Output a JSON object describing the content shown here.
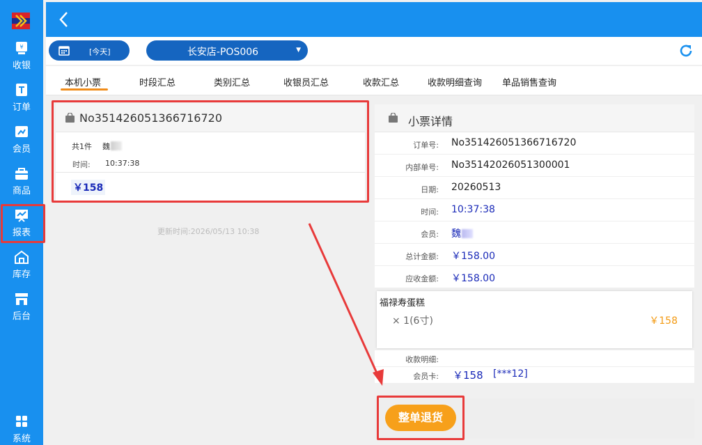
{
  "sidebar": {
    "items": [
      {
        "label": "收银",
        "icon": "cashier-icon"
      },
      {
        "label": "订单",
        "icon": "order-icon"
      },
      {
        "label": "会员",
        "icon": "member-icon"
      },
      {
        "label": "商品",
        "icon": "goods-bag-icon"
      },
      {
        "label": "报表",
        "icon": "report-chart-icon"
      },
      {
        "label": "库存",
        "icon": "warehouse-icon"
      },
      {
        "label": "后台",
        "icon": "store-backend-icon"
      }
    ],
    "system_label": "系统",
    "active": "报表"
  },
  "toolbar": {
    "date_label": "[今天]",
    "store": "长安店-POS006"
  },
  "tabs": [
    "本机小票",
    "时段汇总",
    "类别汇总",
    "收银员汇总",
    "收款汇总",
    "收款明细查询",
    "单品销售查询"
  ],
  "active_tab": "本机小票",
  "ticket": {
    "number": "No351426051366716720",
    "count": "共1件",
    "member": "魏",
    "time_label": "时间:",
    "time": "10:37:38",
    "amount": "￥158"
  },
  "updated_text": "更新时间:2026/05/13 10:38",
  "detail": {
    "title": "小票详情",
    "rows": [
      {
        "label": "订单号:",
        "value": "No351426051366716720"
      },
      {
        "label": "内部单号:",
        "value": "No35142026051300001"
      },
      {
        "label": "日期:",
        "value": "20260513"
      },
      {
        "label": "时间:",
        "value": "10:37:38"
      },
      {
        "label": "会员:",
        "value": "魏"
      },
      {
        "label": "总计金额:",
        "value": "￥158.00"
      },
      {
        "label": "应收金额:",
        "value": "￥158.00"
      }
    ],
    "item": {
      "name": "福禄寿蛋糕",
      "qty": "× 1(6寸)",
      "price": "￥158"
    },
    "payment_label": "收款明细:",
    "card_label": "会员卡:",
    "card_amount": "￥158",
    "card_no": "[***12]"
  },
  "refund_button": "整单退货",
  "colors": {
    "primary": "#1890ef",
    "dark_blue": "#1565c0",
    "accent_orange": "#f7a01a",
    "highlight_red": "#e83a3a"
  }
}
